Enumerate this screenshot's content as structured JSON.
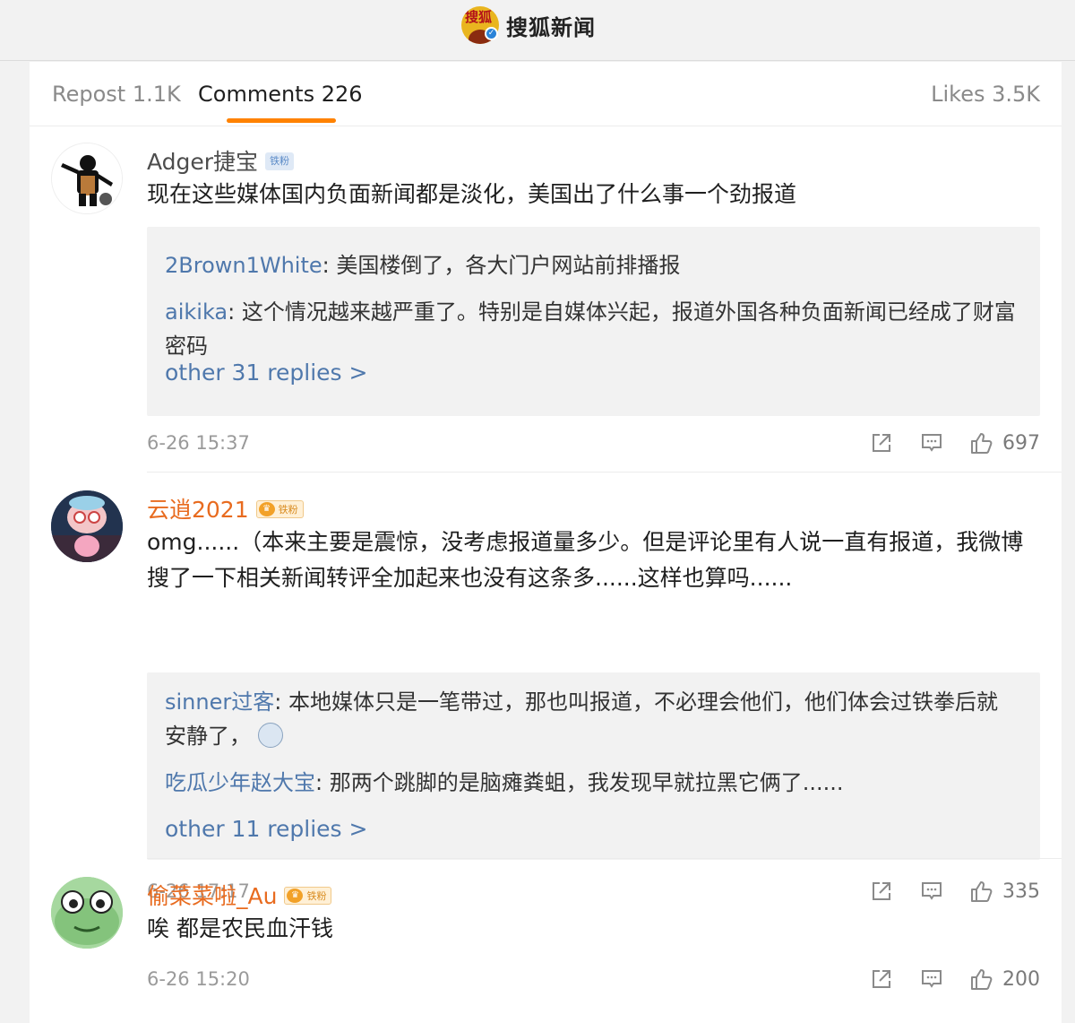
{
  "header": {
    "logo_text": "搜狐",
    "title": "搜狐新闻"
  },
  "tabs": [
    {
      "label": "Repost",
      "count": "1.1K"
    },
    {
      "label": "Comments",
      "count": "226"
    },
    {
      "label": "Likes",
      "count": "3.5K"
    }
  ],
  "tab_labels": {
    "repost": "Repost 1.1K",
    "comments": "Comments 226",
    "likes": "Likes 3.5K"
  },
  "comments": [
    {
      "user": "Adger捷宝",
      "badge": "铁粉",
      "text": "现在这些媒体国内负面新闻都是淡化，美国出了什么事一个劲报道",
      "replies": [
        {
          "who": "2Brown1White",
          "text": ": 美国楼倒了，各大门户网站前排播报"
        },
        {
          "who": "aikika",
          "text": ": 这个情况越来越严重了。特别是自媒体兴起，报道外国各种负面新闻已经成了财富密码"
        }
      ],
      "more": "other 31 replies >",
      "time": "6-26 15:37",
      "likes": "697"
    },
    {
      "user": "云逍2021",
      "badge": "铁粉",
      "text": "omg......（本来主要是震惊，没考虑报道量多少。但是评论里有人说一直有报道，我微博搜了一下相关新闻转评全加起来也没有这条多......这样也算吗......",
      "replies": [
        {
          "who": "sinner过客",
          "text": ": 本地媒体只是一笔带过，那也叫报道，不必理会他们，他们体会过铁拳后就安静了，"
        },
        {
          "who": "吃瓜少年赵大宝",
          "text": ": 那两个跳脚的是脑瘫粪蛆，我发现早就拉黑它俩了......"
        }
      ],
      "more": "other 11 replies >",
      "time": "6-26 17:17",
      "likes": "335"
    },
    {
      "user": "偷菜菜啦_Au",
      "badge": "铁粉",
      "text": "唉 都是农民血汗钱",
      "time": "6-26 15:20",
      "likes": "200"
    }
  ],
  "icons": {
    "share": "share-icon",
    "comment": "comment-icon",
    "like": "thumbs-up-icon"
  },
  "colors": {
    "accent": "#ff8200",
    "link": "#4f78ac",
    "vip_name": "#e86b1f"
  }
}
